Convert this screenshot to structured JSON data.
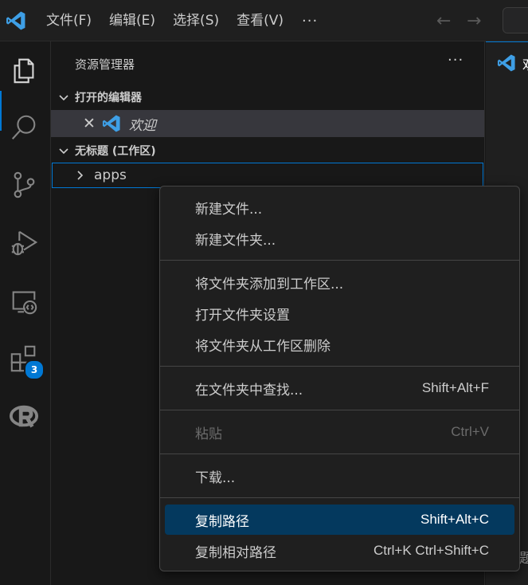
{
  "titlebar": {
    "menu": [
      "文件(F)",
      "编辑(E)",
      "选择(S)",
      "查看(V)"
    ],
    "more": "···",
    "back": "←",
    "forward": "→"
  },
  "activitybar": {
    "items": [
      "files-icon",
      "search-icon",
      "source-control-icon",
      "run-debug-icon",
      "remote-explorer-icon",
      "extensions-icon",
      "r-icon"
    ],
    "extensions_badge": "3"
  },
  "sidebar": {
    "title": "资源管理器",
    "more": "···",
    "open_editors": {
      "header": "打开的编辑器",
      "close": "✕",
      "items": [
        {
          "label": "欢迎"
        }
      ]
    },
    "workspace": {
      "header": "无标题 (工作区)",
      "folders": [
        {
          "label": "apps"
        }
      ]
    }
  },
  "editor": {
    "tab_label": "欢",
    "peek_text": "题"
  },
  "context_menu": {
    "items": [
      {
        "label": "新建文件...",
        "shortcut": ""
      },
      {
        "label": "新建文件夹...",
        "shortcut": ""
      },
      {
        "label": "将文件夹添加到工作区...",
        "shortcut": ""
      },
      {
        "label": "打开文件夹设置",
        "shortcut": ""
      },
      {
        "label": "将文件夹从工作区删除",
        "shortcut": ""
      },
      {
        "label": "在文件夹中查找...",
        "shortcut": "Shift+Alt+F"
      },
      {
        "label": "粘贴",
        "shortcut": "Ctrl+V"
      },
      {
        "label": "下载...",
        "shortcut": ""
      },
      {
        "label": "复制路径",
        "shortcut": "Shift+Alt+C"
      },
      {
        "label": "复制相对路径",
        "shortcut": "Ctrl+K Ctrl+Shift+C"
      }
    ]
  },
  "colors": {
    "accent": "#0078d4",
    "vscode_blue": "#3e9fe6",
    "menu_selected": "#04395e",
    "background": "#181818"
  }
}
